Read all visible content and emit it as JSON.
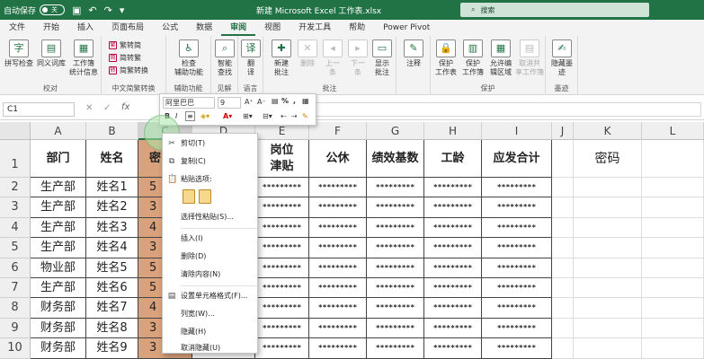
{
  "titlebar": {
    "autosave_label": "自动保存",
    "autosave_state": "关",
    "doc_title": "新建 Microsoft Excel 工作表.xlsx",
    "search_placeholder": "搜索",
    "accent": "#217346"
  },
  "tabs": [
    "文件",
    "开始",
    "插入",
    "页面布局",
    "公式",
    "数据",
    "审阅",
    "视图",
    "开发工具",
    "帮助",
    "Power Pivot"
  ],
  "active_tab": "审阅",
  "ribbon": {
    "groups": {
      "proofing": {
        "name": "校对",
        "spell": "拼写检查",
        "thesaurus": "同义词库",
        "stats": "工作簿\n统计信息"
      },
      "chinese": {
        "name": "中文简繁转换",
        "t2s": "繁转简",
        "s2t": "简转繁",
        "convert": "简繁转换"
      },
      "accessibility": {
        "name": "辅助功能",
        "check": "检查\n辅助功能"
      },
      "insights": {
        "name": "见解",
        "smart": "智能\n查找"
      },
      "language": {
        "name": "语言",
        "translate": "翻\n译"
      },
      "comments": {
        "name": "批注",
        "new": "新建\n批注",
        "delete": "删除",
        "prev": "上一\n条",
        "next": "下一\n条",
        "show": "显示\n批注"
      },
      "notes": {
        "name": "",
        "notes": "注释"
      },
      "protect": {
        "name": "保护",
        "sheet": "保护\n工作表",
        "workbook": "保护\n工作簿",
        "ranges": "允许编\n辑区域",
        "unshare": "取消共\n享工作簿"
      },
      "ink": {
        "name": "墨迹",
        "hide": "隐藏墨\n迹"
      }
    }
  },
  "formula_bar": {
    "name_box": "C1",
    "fx": "fx",
    "cancel": "✕",
    "enter": "✓"
  },
  "mini_toolbar": {
    "font": "阿里巴巴",
    "size": "9",
    "percent": "%",
    "comma": ","
  },
  "sheet": {
    "columns": [
      "A",
      "B",
      "C",
      "D",
      "E",
      "F",
      "G",
      "H",
      "I",
      "J",
      "K",
      "L"
    ],
    "rows": [
      "1",
      "2",
      "3",
      "4",
      "5",
      "6",
      "7",
      "8",
      "9",
      "10"
    ],
    "headers": {
      "A": "部门",
      "B": "姓名",
      "C": "密",
      "E_line1": "岗位",
      "E_line2": "津贴",
      "F": "公休",
      "G": "绩效基数",
      "H": "工龄",
      "I": "应发合计",
      "K": "密码"
    },
    "data": [
      {
        "dept": "生产部",
        "name": "姓名1",
        "c": "5"
      },
      {
        "dept": "生产部",
        "name": "姓名2",
        "c": "3"
      },
      {
        "dept": "生产部",
        "name": "姓名3",
        "c": "4"
      },
      {
        "dept": "生产部",
        "name": "姓名4",
        "c": "3"
      },
      {
        "dept": "物业部",
        "name": "姓名5",
        "c": "5"
      },
      {
        "dept": "生产部",
        "name": "姓名6",
        "c": "5"
      },
      {
        "dept": "财务部",
        "name": "姓名7",
        "c": "4"
      },
      {
        "dept": "财务部",
        "name": "姓名8",
        "c": "3"
      },
      {
        "dept": "财务部",
        "name": "姓名9",
        "c": "3"
      }
    ],
    "masked": "*********",
    "selected_fill": "#d9a27c"
  },
  "context_menu": {
    "cut": "剪切(T)",
    "copy": "复制(C)",
    "paste_options": "粘贴选项:",
    "paste_special": "选择性粘贴(S)...",
    "insert": "插入(I)",
    "delete": "删除(D)",
    "clear": "清除内容(N)",
    "format_cells": "设置单元格格式(F)...",
    "col_width": "列宽(W)...",
    "hide": "隐藏(H)",
    "unhide": "取消隐藏(U)"
  }
}
